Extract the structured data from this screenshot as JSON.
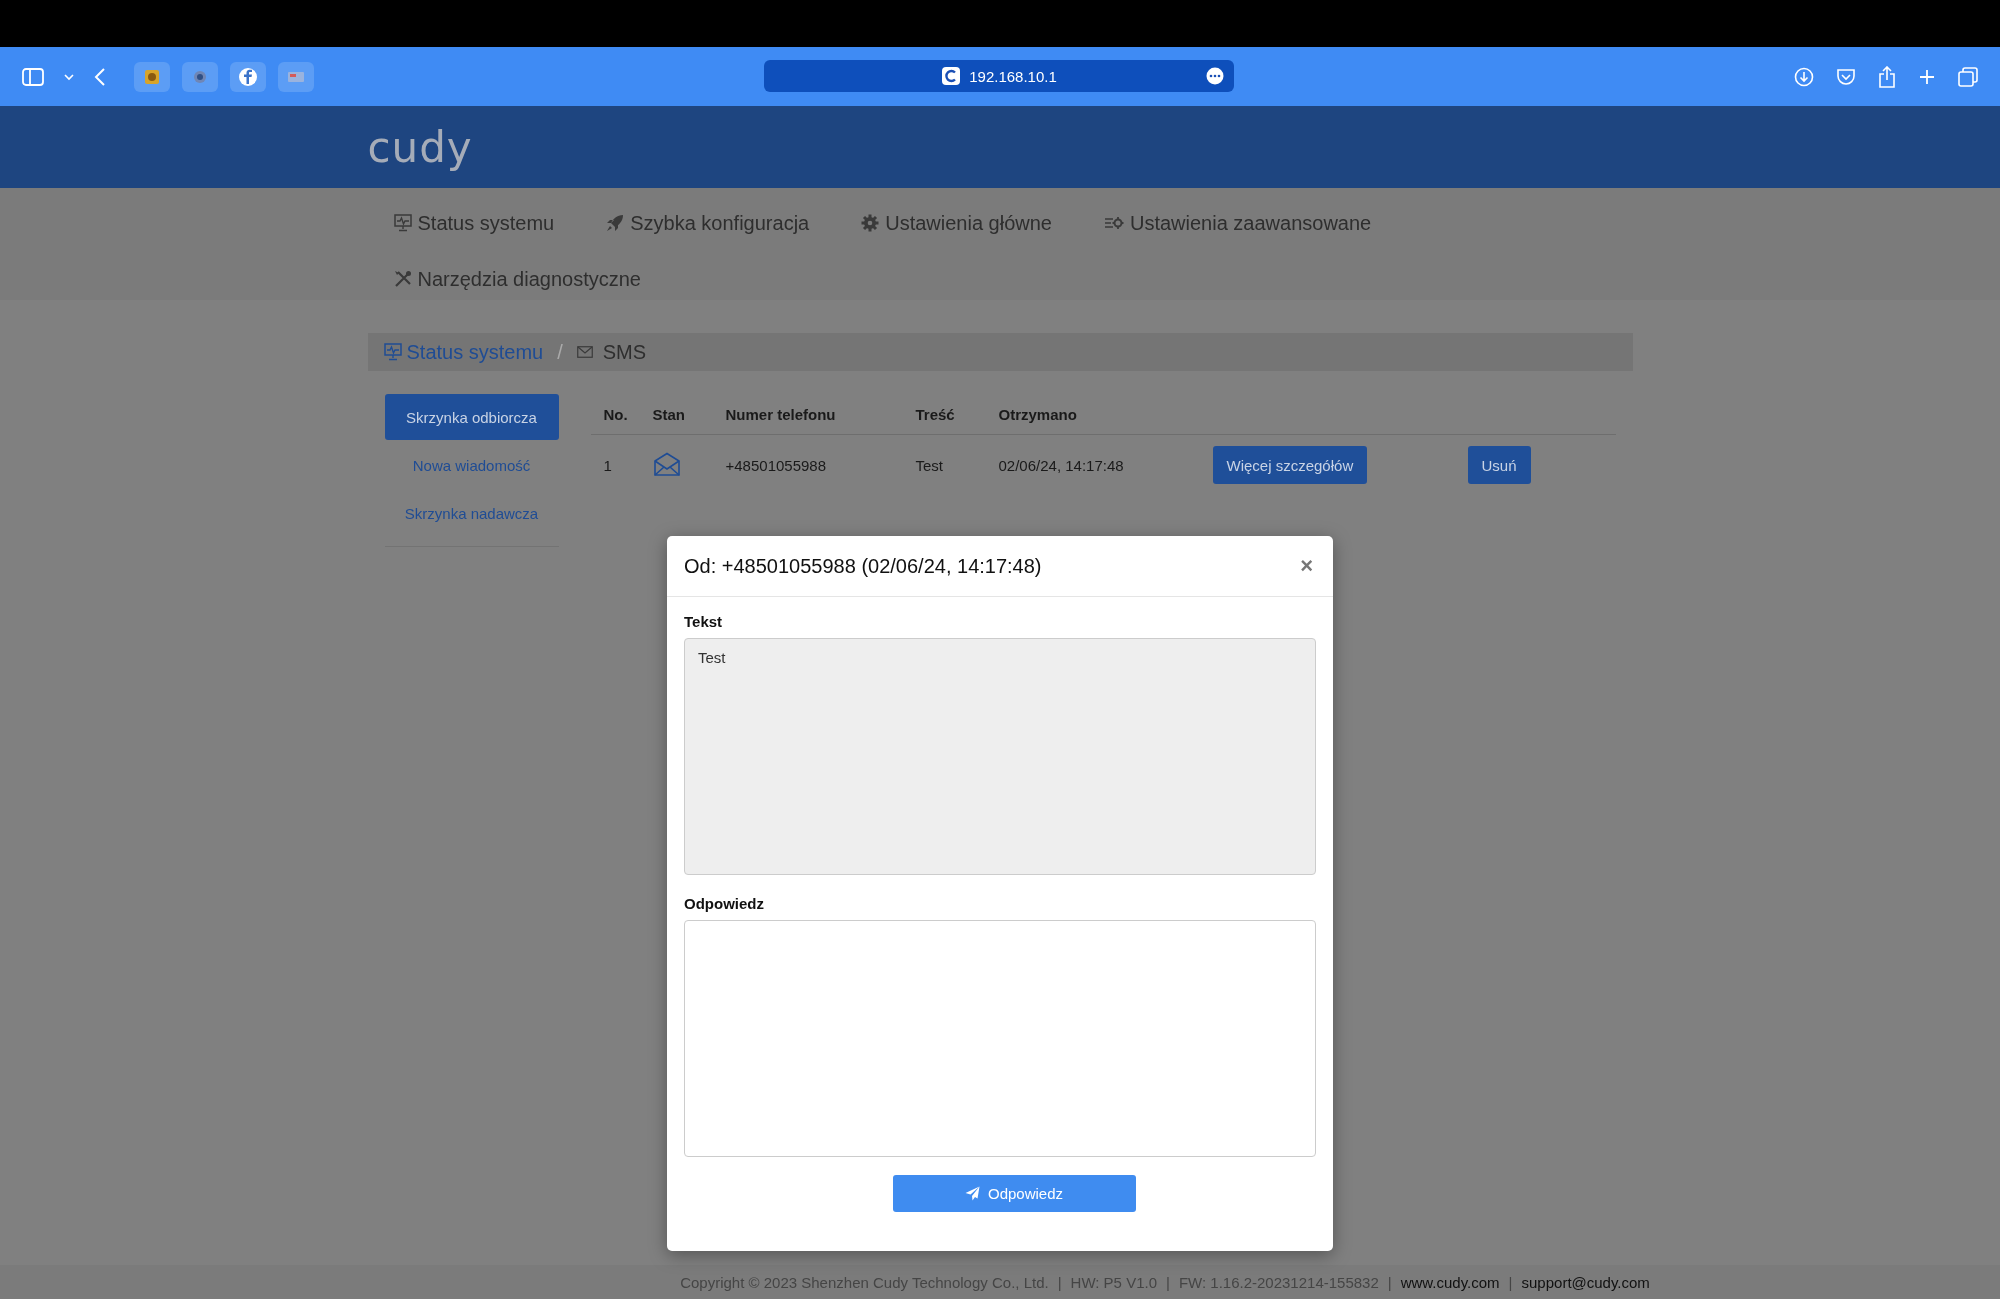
{
  "browser": {
    "address": "192.168.10.1"
  },
  "brand": {
    "logo": "cudy"
  },
  "nav": {
    "items": [
      {
        "label": "Status systemu"
      },
      {
        "label": "Szybka konfiguracja"
      },
      {
        "label": "Ustawienia główne"
      },
      {
        "label": "Ustawienia zaawansowane"
      },
      {
        "label": "Narzędzia diagnostyczne"
      }
    ]
  },
  "breadcrumb": {
    "parent": "Status systemu",
    "separator": "/",
    "current": "SMS"
  },
  "sidebar": {
    "items": [
      {
        "label": "Skrzynka odbiorcza",
        "selected": true
      },
      {
        "label": "Nowa wiadomość",
        "selected": false
      },
      {
        "label": "Skrzynka nadawcza",
        "selected": false
      }
    ]
  },
  "table": {
    "columns": [
      "No.",
      "Stan",
      "Numer telefonu",
      "Treść",
      "Otrzymano"
    ],
    "rows": [
      {
        "no": "1",
        "read": false,
        "phone": "+48501055988",
        "content": "Test",
        "received": "02/06/24, 14:17:48",
        "details": "Więcej szczegółów",
        "delete": "Usuń"
      }
    ]
  },
  "modal": {
    "title": "Od: +48501055988 (02/06/24, 14:17:48)",
    "close": "×",
    "fields": [
      {
        "label": "Tekst",
        "value": "Test",
        "disabled": true
      },
      {
        "label": "Odpowiedz",
        "disabled": false
      }
    ],
    "submit": "Odpowiedz"
  },
  "footer": {
    "separator": "|",
    "items": [
      {
        "text": "Copyright © 2023 Shenzhen Cudy Technology Co., Ltd.",
        "link": false
      },
      {
        "text": "HW: P5 V1.0",
        "link": false
      },
      {
        "text": "FW: 1.16.2-20231214-155832",
        "link": false
      },
      {
        "text": "www.cudy.com",
        "link": true
      },
      {
        "text": "support@cudy.com",
        "link": true
      }
    ]
  }
}
